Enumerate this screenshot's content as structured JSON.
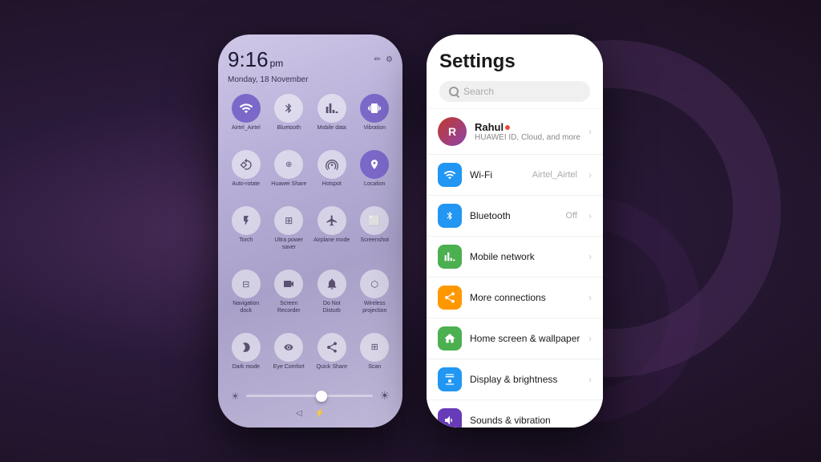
{
  "background": {
    "color": "#3d2a4a"
  },
  "left_phone": {
    "time": "9:16",
    "period": "pm",
    "date": "Monday, 18 November",
    "quick_settings": [
      {
        "id": "wifi",
        "label": "Airtel_Airtel",
        "active": true,
        "icon": "wifi"
      },
      {
        "id": "bluetooth",
        "label": "Bluetooth",
        "active": false,
        "icon": "bt"
      },
      {
        "id": "mobile_data",
        "label": "Mobile data",
        "active": false,
        "icon": "signal"
      },
      {
        "id": "vibration",
        "label": "Vibration",
        "active": true,
        "icon": "vibrate"
      },
      {
        "id": "auto_rotate",
        "label": "Auto-rotate",
        "active": false,
        "icon": "rotate"
      },
      {
        "id": "huawei_share",
        "label": "Huawei Share",
        "active": false,
        "icon": "share"
      },
      {
        "id": "hotspot",
        "label": "Hotspot",
        "active": false,
        "icon": "hotspot"
      },
      {
        "id": "location",
        "label": "Location",
        "active": true,
        "icon": "location"
      },
      {
        "id": "torch",
        "label": "Torch",
        "active": false,
        "icon": "torch"
      },
      {
        "id": "ultra_power",
        "label": "Ultra power saver",
        "active": false,
        "icon": "power"
      },
      {
        "id": "airplane",
        "label": "Airplane mode",
        "active": false,
        "icon": "airplane"
      },
      {
        "id": "screenshot",
        "label": "Screenshot",
        "active": false,
        "icon": "screenshot"
      },
      {
        "id": "nav_dock",
        "label": "Navigation dock",
        "active": false,
        "icon": "nav"
      },
      {
        "id": "screen_recorder",
        "label": "Screen Recorder",
        "active": false,
        "icon": "record"
      },
      {
        "id": "do_not_disturb",
        "label": "Do Not Disturb",
        "active": false,
        "icon": "dnd"
      },
      {
        "id": "wireless_proj",
        "label": "Wireless projection",
        "active": false,
        "icon": "wireless"
      },
      {
        "id": "dark_mode",
        "label": "Dark mode",
        "active": false,
        "icon": "dark"
      },
      {
        "id": "eye_comfort",
        "label": "Eye Comfort",
        "active": false,
        "icon": "eye"
      },
      {
        "id": "quick_share",
        "label": "Quick Share",
        "active": false,
        "icon": "qshare"
      },
      {
        "id": "scan",
        "label": "Scan",
        "active": false,
        "icon": "scan"
      }
    ]
  },
  "right_phone": {
    "title": "Settings",
    "search": {
      "placeholder": "Search"
    },
    "profile": {
      "name": "Rahul",
      "subtitle": "HUAWEI ID, Cloud, and more",
      "has_dot": true
    },
    "items": [
      {
        "id": "wifi",
        "label": "Wi-Fi",
        "value": "Airtel_Airtel",
        "icon_type": "wifi",
        "color": "#2196F3"
      },
      {
        "id": "bluetooth",
        "label": "Bluetooth",
        "value": "Off",
        "icon_type": "bluetooth",
        "color": "#2196F3"
      },
      {
        "id": "mobile_network",
        "label": "Mobile network",
        "value": "",
        "icon_type": "mobile",
        "color": "#4CAF50"
      },
      {
        "id": "more_connections",
        "label": "More connections",
        "value": "",
        "icon_type": "more",
        "color": "#FF9800"
      },
      {
        "id": "home_wallpaper",
        "label": "Home screen & wallpaper",
        "value": "",
        "icon_type": "home",
        "color": "#4CAF50"
      },
      {
        "id": "display",
        "label": "Display & brightness",
        "value": "",
        "icon_type": "display",
        "color": "#2196F3"
      },
      {
        "id": "sounds",
        "label": "Sounds & vibration",
        "value": "",
        "icon_type": "sound",
        "color": "#673AB7"
      }
    ]
  }
}
